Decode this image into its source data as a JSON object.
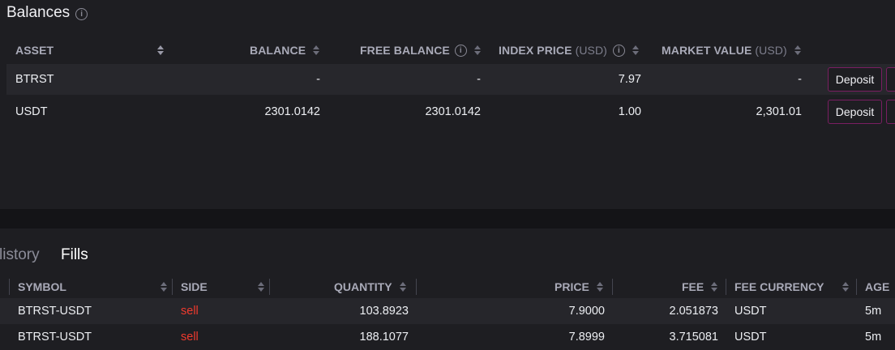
{
  "balances": {
    "title": "Balances",
    "columns": {
      "asset": "ASSET",
      "balance": "BALANCE",
      "free_balance": "FREE BALANCE",
      "index_price": "INDEX PRICE",
      "index_price_unit": "(USD)",
      "market_value": "MARKET VALUE",
      "market_value_unit": "(USD)"
    },
    "rows": [
      {
        "asset": "BTRST",
        "balance": "-",
        "free_balance": "-",
        "index_price": "7.97",
        "market_value": "-",
        "deposit_label": "Deposit"
      },
      {
        "asset": "USDT",
        "balance": "2301.0142",
        "free_balance": "2301.0142",
        "index_price": "1.00",
        "market_value": "2,301.01",
        "deposit_label": "Deposit"
      }
    ]
  },
  "tabs": [
    {
      "label": "listory",
      "active": false
    },
    {
      "label": "Fills",
      "active": true
    }
  ],
  "fills": {
    "columns": {
      "symbol": "SYMBOL",
      "side": "SIDE",
      "quantity": "QUANTITY",
      "price": "PRICE",
      "fee": "FEE",
      "fee_currency": "FEE CURRENCY",
      "age": "AGE"
    },
    "rows": [
      {
        "symbol": "BTRST-USDT",
        "side": "sell",
        "quantity": "103.8923",
        "price": "7.9000",
        "fee": "2.051873",
        "fee_currency": "USDT",
        "age": "5m"
      },
      {
        "symbol": "BTRST-USDT",
        "side": "sell",
        "quantity": "188.1077",
        "price": "7.8999",
        "fee": "3.715081",
        "fee_currency": "USDT",
        "age": "5m"
      }
    ]
  },
  "colors": {
    "background": "#1e1e22",
    "row_alt": "#27272c",
    "sell": "#f03a2e",
    "deposit_border": "#7a1e62"
  }
}
